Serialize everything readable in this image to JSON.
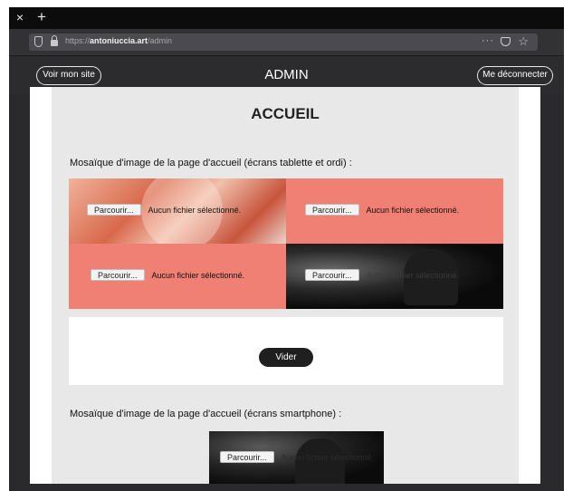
{
  "browser": {
    "close_glyph": "×",
    "new_tab_glyph": "+",
    "url_prefix": "https://",
    "url_host": "antoniuccia.art",
    "url_path": "/admin",
    "menu_glyph": "···",
    "star_glyph": "☆"
  },
  "header": {
    "site_button": "Voir mon site",
    "title": "ADMIN",
    "logout_button": "Me déconnecter"
  },
  "main": {
    "title": "ACCUEIL",
    "desktop_label": "Mosaïque d'image de la page d'accueil (écrans tablette et ordi) :",
    "tiles": [
      {
        "browse": "Parcourir...",
        "status": "Aucun fichier sélectionné."
      },
      {
        "browse": "Parcourir...",
        "status": "Aucun fichier sélectionné."
      },
      {
        "browse": "Parcourir...",
        "status": "Aucun fichier sélectionné."
      },
      {
        "browse": "Parcourir...",
        "status": "Aucun fichier sélectionné."
      }
    ],
    "clear_button": "Vider",
    "mobile_label": "Mosaïque d'image de la page d'accueil (écrans smartphone) :",
    "mobile_tile": {
      "browse": "Parcourir...",
      "status": "Aucun fichier sélectionné."
    }
  }
}
